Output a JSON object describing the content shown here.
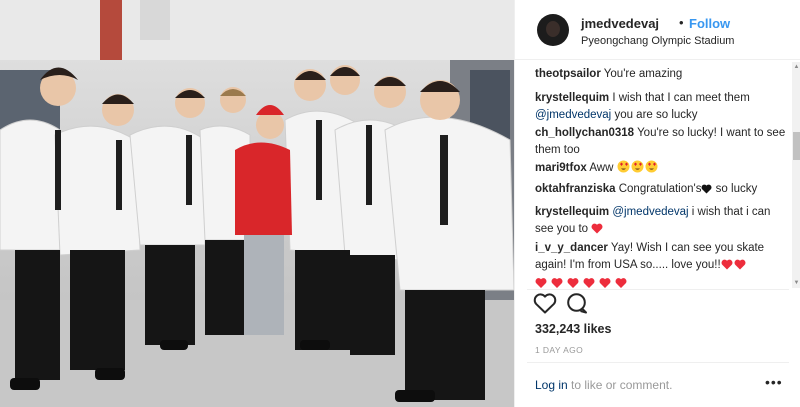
{
  "post": {
    "username": "jmedvedevaj",
    "separator": "•",
    "follow_label": "Follow",
    "location": "Pyeongchang Olympic Stadium",
    "likes": "332,243 likes",
    "time_ago": "1 DAY AGO",
    "login_link": "Log in",
    "login_rest": " to like or comment.",
    "more_label": "•••"
  },
  "comments": [
    {
      "user": "theotpsailor",
      "segments": [
        {
          "text": " You're amazing"
        }
      ]
    },
    {
      "user": "krystellequim",
      "segments": [
        {
          "text": " I wish that I can meet them "
        },
        {
          "mention": "@jmedvedevaj"
        },
        {
          "text": " you are so lucky"
        }
      ]
    },
    {
      "user": "ch_hollychan0318",
      "segments": [
        {
          "text": " You're so lucky! I want to see them too"
        }
      ]
    },
    {
      "user": "mari9tfox",
      "segments": [
        {
          "text": " Aww"
        },
        {
          "emoji": "heart-eyes",
          "count": 3
        }
      ]
    },
    {
      "user": "oktahfranziska",
      "segments": [
        {
          "text": " Congratulation's"
        },
        {
          "emoji": "black-heart",
          "count": 1
        },
        {
          "text": " so lucky"
        }
      ]
    },
    {
      "user": "krystellequim",
      "segments": [
        {
          "text": " "
        },
        {
          "mention": "@jmedvedevaj"
        },
        {
          "text": " i wish that i can see you to "
        },
        {
          "emoji": "red-heart",
          "count": 1
        }
      ]
    },
    {
      "user": "i_v_y_dancer",
      "segments": [
        {
          "text": " Yay! Wish I can see you skate again! I'm from USA so..... love you!!"
        },
        {
          "emoji": "red-heart",
          "count": 2
        },
        {
          "break": true
        },
        {
          "emoji": "red-heart",
          "count": 6
        }
      ]
    }
  ],
  "icons": {
    "like": "heart-outline-icon",
    "comment": "comment-bubble-icon",
    "scroll_up": "▲",
    "scroll_down": "▼"
  },
  "colors": {
    "link": "#003569",
    "follow": "#3897f0",
    "muted": "#999999",
    "heart": "#ed2d3c"
  }
}
